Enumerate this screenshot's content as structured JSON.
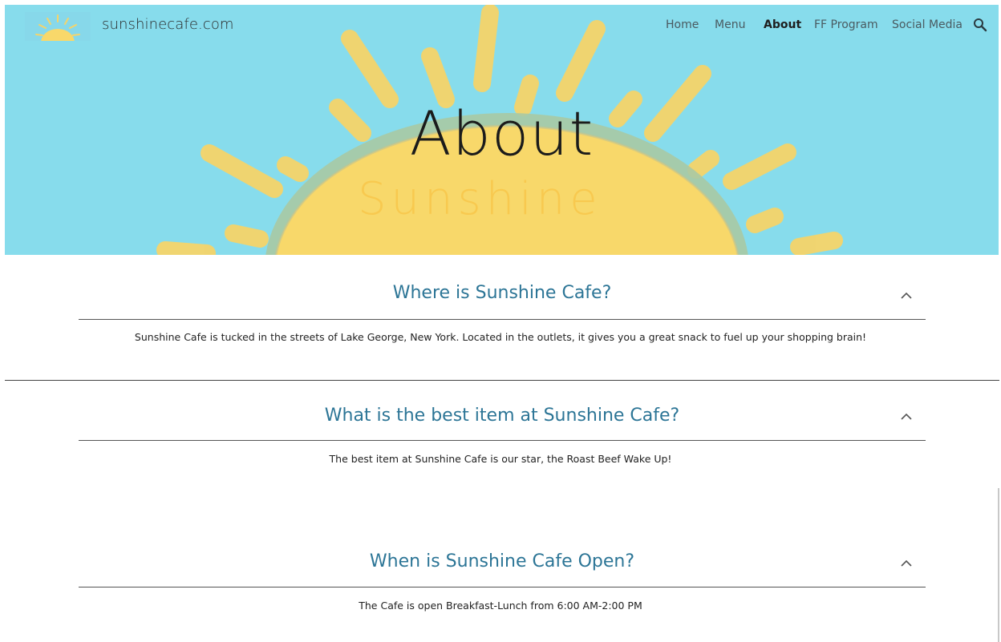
{
  "site": {
    "name": "sunshinecafe.com"
  },
  "nav": {
    "items": [
      {
        "label": "Home"
      },
      {
        "label": "Menu"
      },
      {
        "label": "About"
      },
      {
        "label": "FF Program"
      },
      {
        "label": "Social Media"
      }
    ],
    "active": "About",
    "search_icon": "search-icon"
  },
  "hero": {
    "title": "About",
    "word": "Sunshine"
  },
  "faq": [
    {
      "question": "Where is Sunshine Cafe?",
      "answer": "Sunshine Cafe is tucked in the streets of Lake George, New York. Located in the outlets, it gives you a great snack to fuel up your shopping brain!",
      "icon": "chevron-up-icon"
    },
    {
      "question": "What is the best item at Sunshine Cafe?",
      "answer": "The best item at Sunshine Cafe is our star, the Roast Beef Wake Up!",
      "icon": "chevron-up-icon"
    },
    {
      "question": "When is Sunshine Cafe Open?",
      "answer": "The Cafe is open Breakfast-Lunch from 6:00 AM-2:00 PM",
      "icon": "chevron-up-icon"
    }
  ],
  "colors": {
    "sky": "#87dcec",
    "sun": "#fbd96b",
    "sun_edge": "#b9c98a",
    "heading": "#2c7596"
  }
}
